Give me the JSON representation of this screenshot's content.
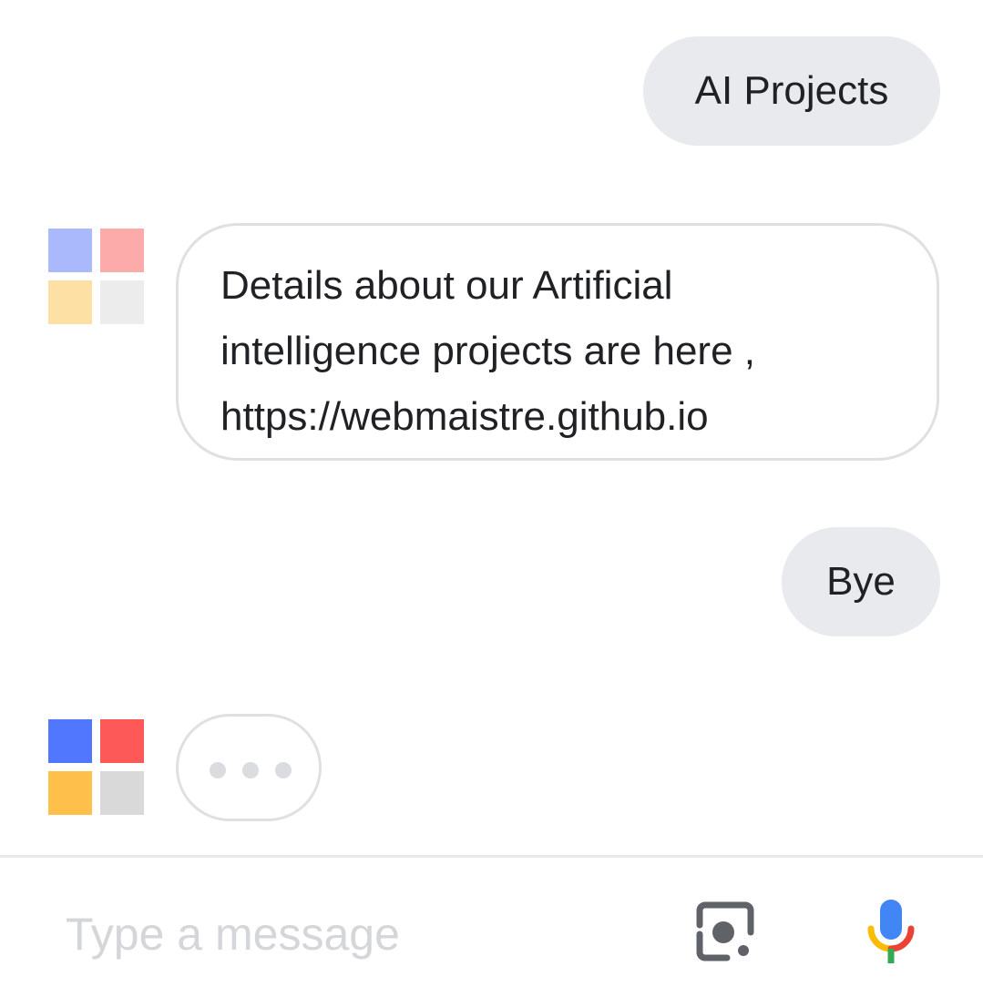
{
  "conversation": {
    "user_message_1": "AI Projects",
    "assistant_message_1": {
      "line_1": "Details about our Artificial",
      "line_2": "intelligence projects are here ,",
      "line_3": "https://webmaistre.github.io"
    },
    "user_message_2": "Bye",
    "assistant_typing": true
  },
  "avatar": {
    "icon": "google-assistant-squares-icon",
    "faded_colors": [
      "#aab8fc",
      "#fdaaaa",
      "#fde0a3",
      "#ececec"
    ],
    "active_colors": [
      "#5177fe",
      "#fe5959",
      "#fec04b",
      "#d9d9d9"
    ]
  },
  "input_bar": {
    "placeholder": "Type a message",
    "lens_icon": "lens-camera-icon",
    "mic_icon": "microphone-icon"
  },
  "colors": {
    "user_bubble_bg": "#e8eaed",
    "assistant_bubble_border": "#e0e0e0",
    "text": "#202124",
    "placeholder": "#d4d6d9",
    "mic_blue": "#4285f4",
    "mic_red": "#ea4335",
    "mic_yellow": "#fbbc05",
    "mic_green": "#34a853",
    "lens_gray": "#5f6368"
  }
}
